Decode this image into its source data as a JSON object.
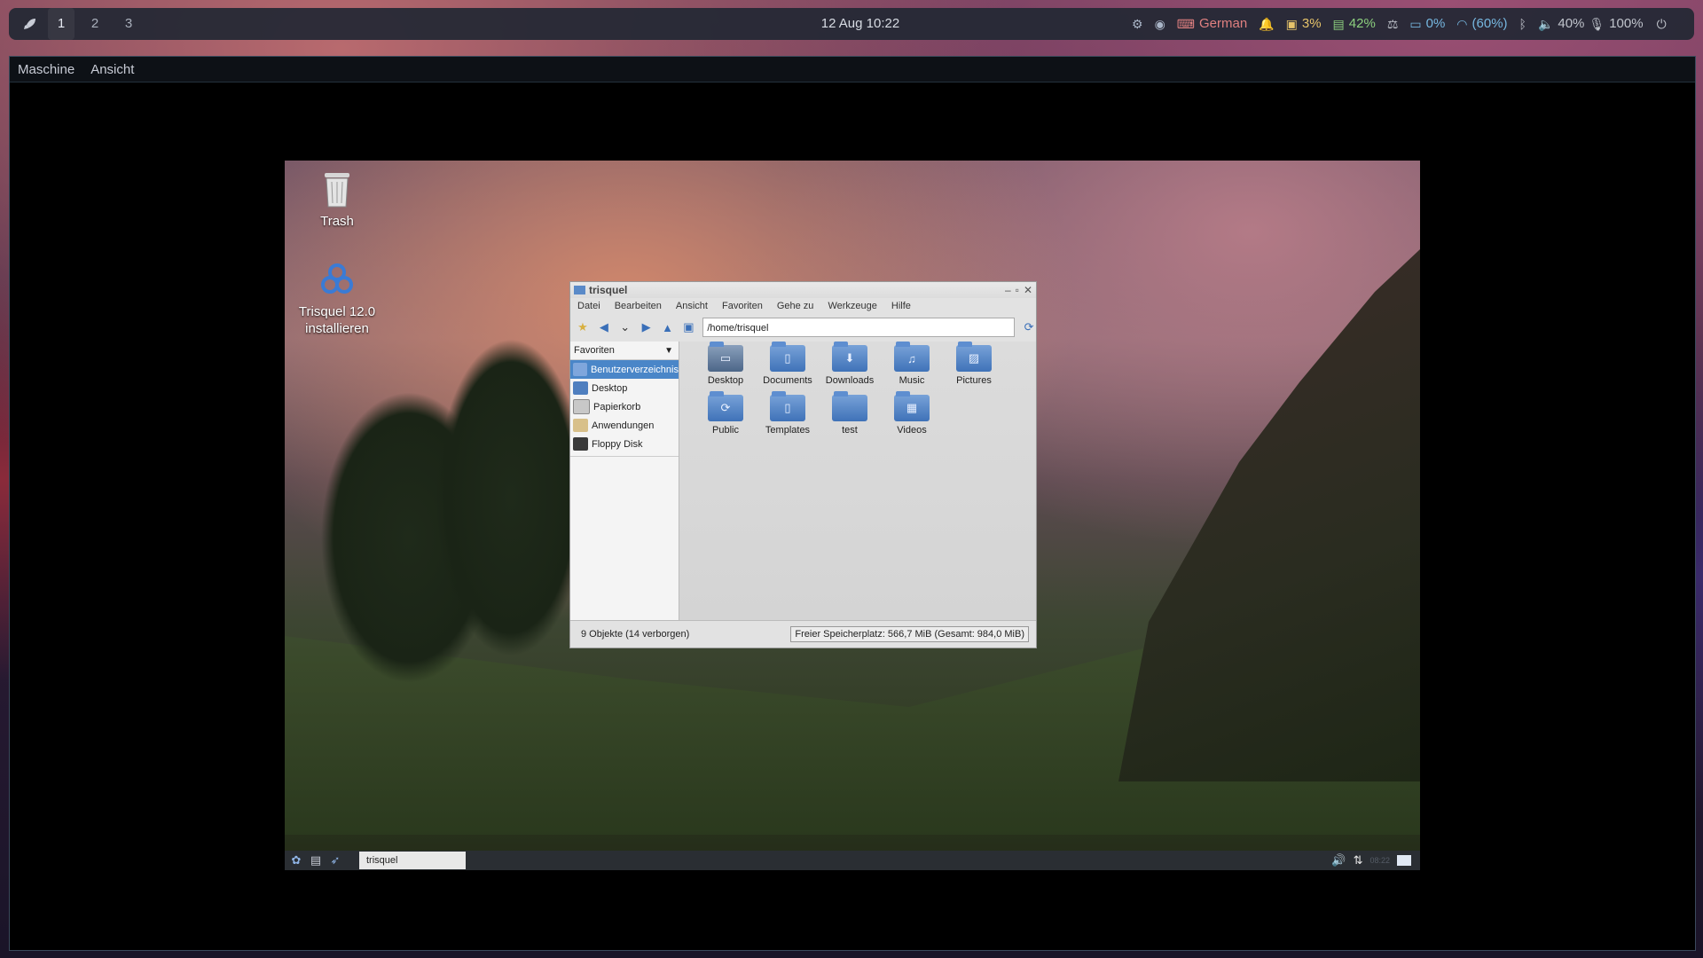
{
  "topbar": {
    "workspaces": [
      "1",
      "2",
      "3"
    ],
    "clock": "12 Aug 10:22",
    "keyboard": "German",
    "cpu": "3%",
    "memory": "42%",
    "battery": "0%",
    "wifi": "(60%)",
    "volume": "40%",
    "mic": "100%"
  },
  "vm": {
    "menu": [
      "Maschine",
      "Ansicht"
    ]
  },
  "desktop": {
    "trash_label": "Trash",
    "install_label_1": "Trisquel 12.0",
    "install_label_2": "installieren"
  },
  "file_manager": {
    "title": "trisquel",
    "menu": [
      "Datei",
      "Bearbeiten",
      "Ansicht",
      "Favoriten",
      "Gehe zu",
      "Werkzeuge",
      "Hilfe"
    ],
    "address": "/home/trisquel",
    "sidebar_header": "Favoriten",
    "sidebar_items": [
      "Benutzerverzeichnis",
      "Desktop",
      "Papierkorb",
      "Anwendungen",
      "Floppy Disk"
    ],
    "files": [
      "Desktop",
      "Documents",
      "Downloads",
      "Music",
      "Pictures",
      "Public",
      "Templates",
      "test",
      "Videos"
    ],
    "status_left": "9 Objekte (14 verborgen)",
    "status_right": "Freier Speicherplatz: 566,7 MiB (Gesamt: 984,0 MiB)"
  },
  "guest_taskbar": {
    "task_label": "trisquel",
    "clock": "08:22"
  },
  "colors": {
    "accent": "#4a86c8",
    "folder": "#4a7cc0"
  }
}
